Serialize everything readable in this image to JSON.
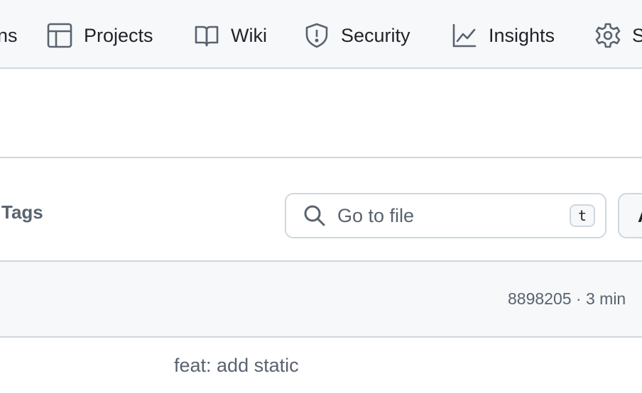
{
  "repo_nav": {
    "items": [
      {
        "label": "ns",
        "icon": "actions-icon"
      },
      {
        "label": "Projects",
        "icon": "table-icon"
      },
      {
        "label": "Wiki",
        "icon": "book-icon"
      },
      {
        "label": "Security",
        "icon": "shield-icon"
      },
      {
        "label": "Insights",
        "icon": "graph-icon"
      },
      {
        "label": "S",
        "icon": "gear-icon"
      }
    ]
  },
  "toolbar": {
    "tags_label": "Tags",
    "search_placeholder": "Go to file",
    "shortcut_key": "t",
    "add_file_label": "A"
  },
  "commit_bar": {
    "meta": "8898205 · 3 min"
  },
  "file_row": {
    "commit_message": "feat: add static"
  },
  "colors": {
    "nav_bg": "#f6f8fa",
    "border": "#d0d7de",
    "muted_text": "#59636e",
    "primary_text": "#1f2328"
  }
}
